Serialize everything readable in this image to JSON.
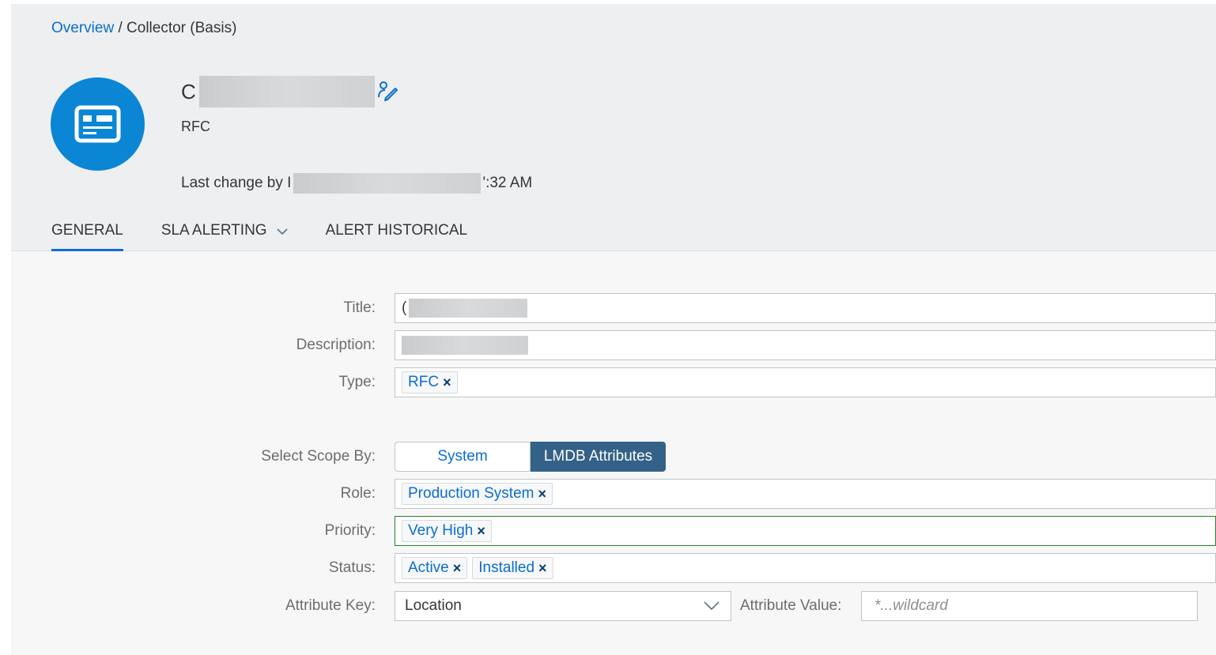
{
  "breadcrumb": {
    "link": "Overview",
    "separator": " / ",
    "current": "Collector (Basis)"
  },
  "header": {
    "title_visible": "C",
    "subtitle": "RFC",
    "last_change_prefix": "Last change by I",
    "last_change_suffix": "':32 AM",
    "avatar_icon": "card-icon",
    "edit_icon": "edit-person-icon"
  },
  "tabs": [
    {
      "label": "GENERAL",
      "active": true
    },
    {
      "label": "SLA ALERTING",
      "has_dropdown": true
    },
    {
      "label": "ALERT HISTORICAL"
    }
  ],
  "form": {
    "title": {
      "label": "Title:",
      "value_visible": "("
    },
    "description": {
      "label": "Description:"
    },
    "type": {
      "label": "Type:",
      "tokens": [
        "RFC"
      ]
    },
    "scope": {
      "label": "Select Scope By:",
      "options": [
        "System",
        "LMDB Attributes"
      ],
      "selected": "LMDB Attributes"
    },
    "role": {
      "label": "Role:",
      "tokens": [
        "Production System"
      ]
    },
    "priority": {
      "label": "Priority:",
      "tokens": [
        "Very High"
      ]
    },
    "status": {
      "label": "Status:",
      "tokens": [
        "Active",
        "Installed"
      ]
    },
    "attribute_key": {
      "label": "Attribute Key:",
      "value": "Location"
    },
    "attribute_value": {
      "label": "Attribute Value:",
      "placeholder": "*...wildcard",
      "value": ""
    }
  },
  "token_remove_glyph": "×",
  "colors": {
    "accent": "#0a6ed1",
    "avatar": "#0a86d4",
    "selected_segment": "#346187",
    "focus_border": "#2b7d2b",
    "header_bg": "#edeff0"
  }
}
